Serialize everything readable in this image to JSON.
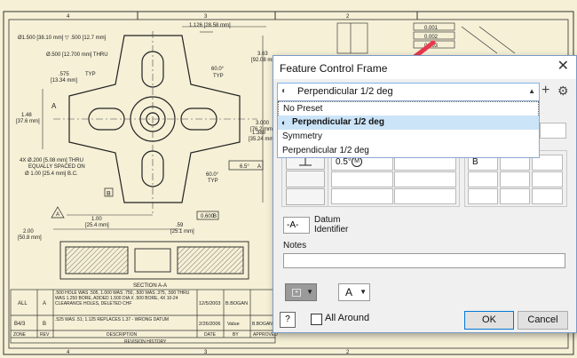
{
  "drawing": {
    "zone_numbers": [
      "4",
      "3",
      "2",
      "4",
      "3",
      "2"
    ],
    "dims": {
      "hole_spec": "Ø1.500 [38.10 mm] ▽ .500 [12.7 mm]",
      "thru_hole": "Ø.500 [12.700 mm] THRU",
      "typ_575": ".575",
      "typ_575_mm": "[13.34 mm]",
      "typ": "TYP",
      "top_dim": "1.126 [28.58 mm]",
      "dim_363": "3.63",
      "dim_363_mm": "[92.08 mm]",
      "ang_60": "60.0°",
      "typ2": "TYP",
      "dim_148": "1.48",
      "dim_148_mm": "[37.6 mm]",
      "dim_3000": "3.000",
      "dim_3000_mm": "[76.2 mm]",
      "dim_1388": "1.388",
      "dim_1388_mm": "[35.24 mm]",
      "hole_4x_1": "4X Ø.200 [5.08 mm] THRU",
      "hole_4x_2": "EQUALLY SPACED ON",
      "hole_4x_3": "Ø 1.00 [25.4 mm] B.C.",
      "ang_60_2": "60.0°",
      "typ3": "TYP",
      "fcf_tol": "6.5°",
      "fcf_datum": "A",
      "datum_a": "A",
      "datum_b": "B",
      "dim_100": "1.00",
      "dim_100_mm": "[25.4 mm]",
      "dim_200": "2.00",
      "dim_200_mm": "[50.8 mm]",
      "dim_59": ".59",
      "dim_59_mm": "[25.1 mm]",
      "fcf2_tol": "0.600",
      "fcf2_datum": "B",
      "top_fcf_1": "0.001",
      "top_fcf_2": "0.002",
      "top_fcf_3": "0.003",
      "section": "SECTION A-A",
      "tri_label": "A"
    },
    "revision_table": {
      "rows": [
        {
          "zone": "ALL",
          "rev": "A",
          "desc": ".500 HOLE WAS .505, 1.000 WAS .750, .500 WAS .375, .500 THRU WAS 1.250 BORE, ADDED 1.500 DIA X .500 BORE, 4X 10-24 CLEARANCE HOLES, DELETED CHF",
          "date": "12/5/2003",
          "by": "B.BOGAN"
        },
        {
          "zone": "B4/3",
          "rev": "B",
          "desc": ".525 WAS .51; 1.125 REPLACES 1.37 - WRONG DATUM",
          "date": "2/26/2006",
          "by": "Value",
          "approved": "B.BOGAN"
        }
      ],
      "headers": [
        "ZONE",
        "REV",
        "DESCRIPTION",
        "DATE",
        "BY",
        "APPROVED"
      ],
      "title": "REVISION HISTORY"
    }
  },
  "dialog": {
    "title": "Feature Control Frame",
    "close": "✕",
    "preset_value": "Perpendicular 1/2 deg",
    "preset_options": [
      "No Preset",
      "Perpendicular 1/2 deg",
      "Symmetry",
      "Perpendicular 1/2 deg"
    ],
    "selected_option_index": 1,
    "tolerance_value": "0.5°",
    "material_modifier": "M",
    "datum_value": "B",
    "datum_identifier_value": "-A-",
    "datum_identifier_label": "Datum",
    "datum_identifier_label2": "Identifier",
    "notes_label": "Notes",
    "notes_value": "",
    "letter_value": "A",
    "all_around_label": "All Around",
    "all_around_checked": false,
    "ok_label": "OK",
    "cancel_label": "Cancel",
    "help_label": "?"
  },
  "annotation": {
    "arrow_color": "#e8384d"
  }
}
